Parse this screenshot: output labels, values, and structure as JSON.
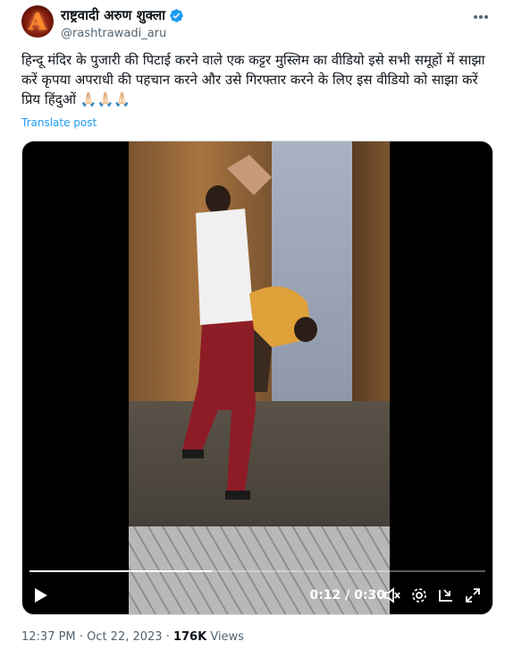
{
  "author": {
    "display_name": "राष्ट्रवादी अरुण शुक्ला",
    "handle": "@rashtrawadi_aru",
    "avatar_letter": "A",
    "verified": true
  },
  "tweet": {
    "text": "हिन्दू मंदिर के पुजारी की पिटाई करने वाले एक कट्टर मुस्लिम का वीडियो इसे सभी समूहों में साझा करें कृपया अपराधी की पहचान करने और उसे गिरफ्तार करने के लिए इस वीडियो को साझा करें प्रिय हिंदुओं 🙏🏻🙏🏻🙏🏻",
    "translate_label": "Translate post"
  },
  "video": {
    "current_time": "0:12",
    "separator": " / ",
    "duration": "0:30",
    "progress_fraction": 0.4
  },
  "footer": {
    "time": "12:37 PM",
    "dot": " · ",
    "date": "Oct 22, 2023",
    "dot2": " · ",
    "views_count": "176K",
    "views_label": " Views"
  },
  "colors": {
    "accent": "#1d9bf0",
    "verified": "#1d9bf0",
    "muted": "#536471"
  }
}
